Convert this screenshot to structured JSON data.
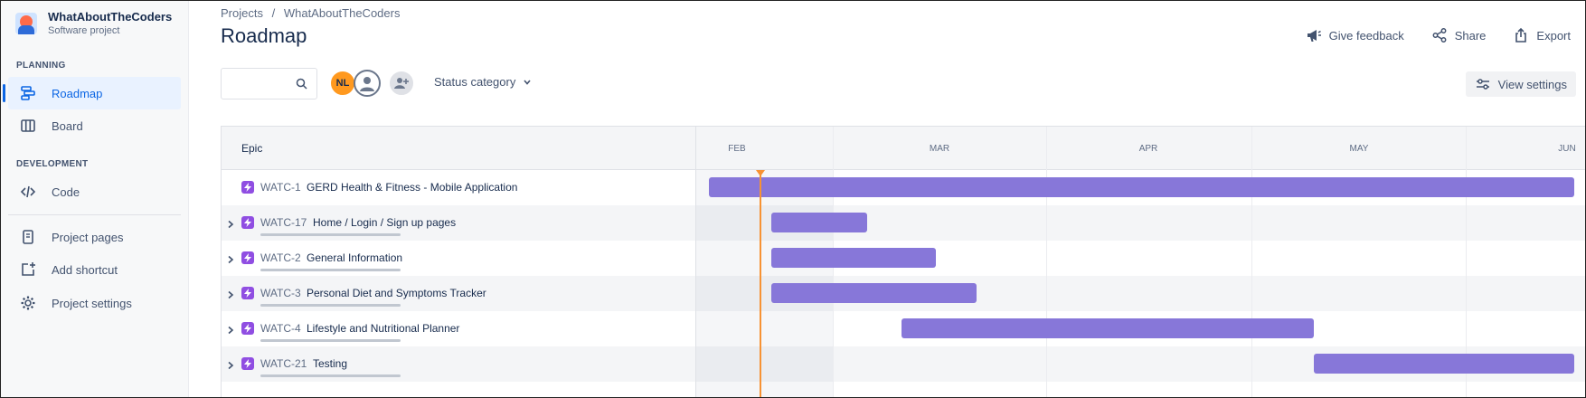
{
  "project": {
    "name": "WhatAboutTheCoders",
    "type": "Software project"
  },
  "sidebar": {
    "planning_label": "PLANNING",
    "development_label": "DEVELOPMENT",
    "items": [
      {
        "label": "Roadmap",
        "icon": "roadmap-icon",
        "active": true
      },
      {
        "label": "Board",
        "icon": "board-icon",
        "active": false
      },
      {
        "label": "Code",
        "icon": "code-icon",
        "active": false
      },
      {
        "label": "Project pages",
        "icon": "pages-icon",
        "active": false
      },
      {
        "label": "Add shortcut",
        "icon": "add-shortcut-icon",
        "active": false
      },
      {
        "label": "Project settings",
        "icon": "gear-icon",
        "active": false
      }
    ]
  },
  "breadcrumb": [
    "Projects",
    "/",
    "WhatAboutTheCoders"
  ],
  "page_title": "Roadmap",
  "actions": {
    "feedback": "Give feedback",
    "share": "Share",
    "export": "Export"
  },
  "toolbar": {
    "search_value": "",
    "avatar_initials": "NL",
    "status_filter": "Status category",
    "view_settings": "View settings"
  },
  "roadmap": {
    "epic_header": "Epic",
    "months": [
      "FEB",
      "MAR",
      "APR",
      "MAY",
      "JUN"
    ],
    "rows": [
      {
        "key": "WATC-1",
        "title": "GERD Health & Fitness - Mobile Application",
        "expandable": false,
        "start": "Jan 22",
        "end": "Jun 30"
      },
      {
        "key": "WATC-17",
        "title": "Home / Login / Sign up pages",
        "expandable": true,
        "start": "Feb 10",
        "end": "Feb 25"
      },
      {
        "key": "WATC-2",
        "title": "General Information",
        "expandable": true,
        "start": "Feb 10",
        "end": "Mar 8"
      },
      {
        "key": "WATC-3",
        "title": "Personal Diet and Symptoms Tracker",
        "expandable": true,
        "start": "Feb 10",
        "end": "Mar 14"
      },
      {
        "key": "WATC-4",
        "title": "Lifestyle and Nutritional Planner",
        "expandable": true,
        "start": "Mar 3",
        "end": "May 8"
      },
      {
        "key": "WATC-21",
        "title": "Testing",
        "expandable": true,
        "start": "May 8",
        "end": "Jun 30"
      }
    ]
  },
  "colors": {
    "accent": "#0c66e4",
    "epic_bar": "#8777d9",
    "epic_icon": "#904ee2",
    "today_line": "#f79233"
  }
}
